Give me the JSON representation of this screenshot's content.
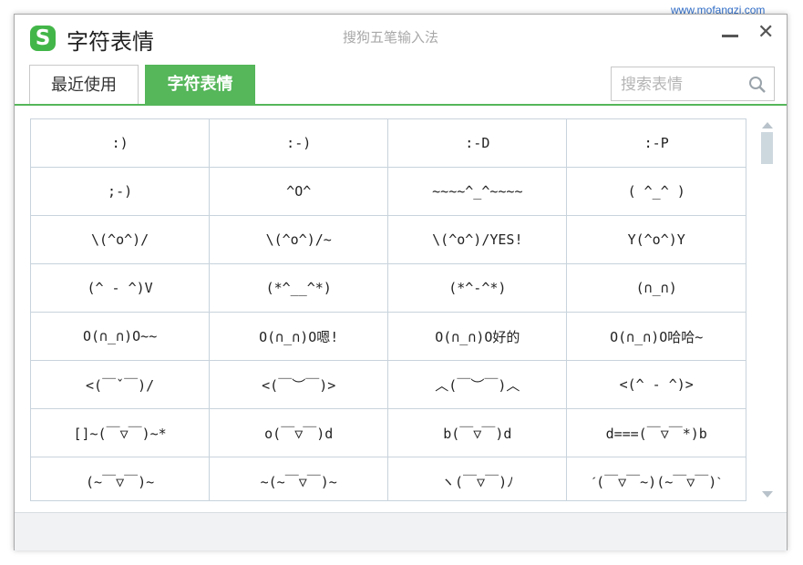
{
  "window": {
    "title": "字符表情",
    "app_name": "搜狗五笔输入法",
    "logo_letter": "S",
    "close_label": "✕",
    "watermark": "www.mofangzj.com"
  },
  "colors": {
    "accent": "#55b65a",
    "logo": "#43b649"
  },
  "tabs": [
    {
      "label": "最近使用",
      "active": false
    },
    {
      "label": "字符表情",
      "active": true
    }
  ],
  "search": {
    "placeholder": "搜索表情",
    "value": "",
    "icon": "search-icon"
  },
  "emoticons": [
    [
      ":)",
      ":-)",
      ":-D",
      ":-P"
    ],
    [
      ";-)",
      "^O^",
      "~~~~^_^~~~~",
      "( ^_^ )"
    ],
    [
      "\\(^o^)/",
      "\\(^o^)/~",
      "\\(^o^)/YES!",
      "Y(^o^)Y"
    ],
    [
      "(^ - ^)V",
      "(*^__^*)",
      "(*^-^*)",
      "(∩_∩)"
    ],
    [
      "O(∩_∩)O~~",
      "O(∩_∩)O嗯!",
      "O(∩_∩)O好的",
      "O(∩_∩)O哈哈~"
    ],
    [
      "<(￣ˇ￣)/",
      "<(￣︶￣)>",
      "︿(￣︶￣)︿",
      "<(^ - ^)>"
    ],
    [
      "[]~(￣▽￣)~*",
      "o(￣▽￣)d",
      "b(￣▽￣)d",
      "d===(￣▽￣*)b"
    ],
    [
      "(~￣▽￣)~",
      "~(~￣▽￣)~",
      "ヽ(￣▽￣)ﾉ",
      "ˊ(￣▽￣~)(~￣▽￣)ˋ"
    ]
  ]
}
